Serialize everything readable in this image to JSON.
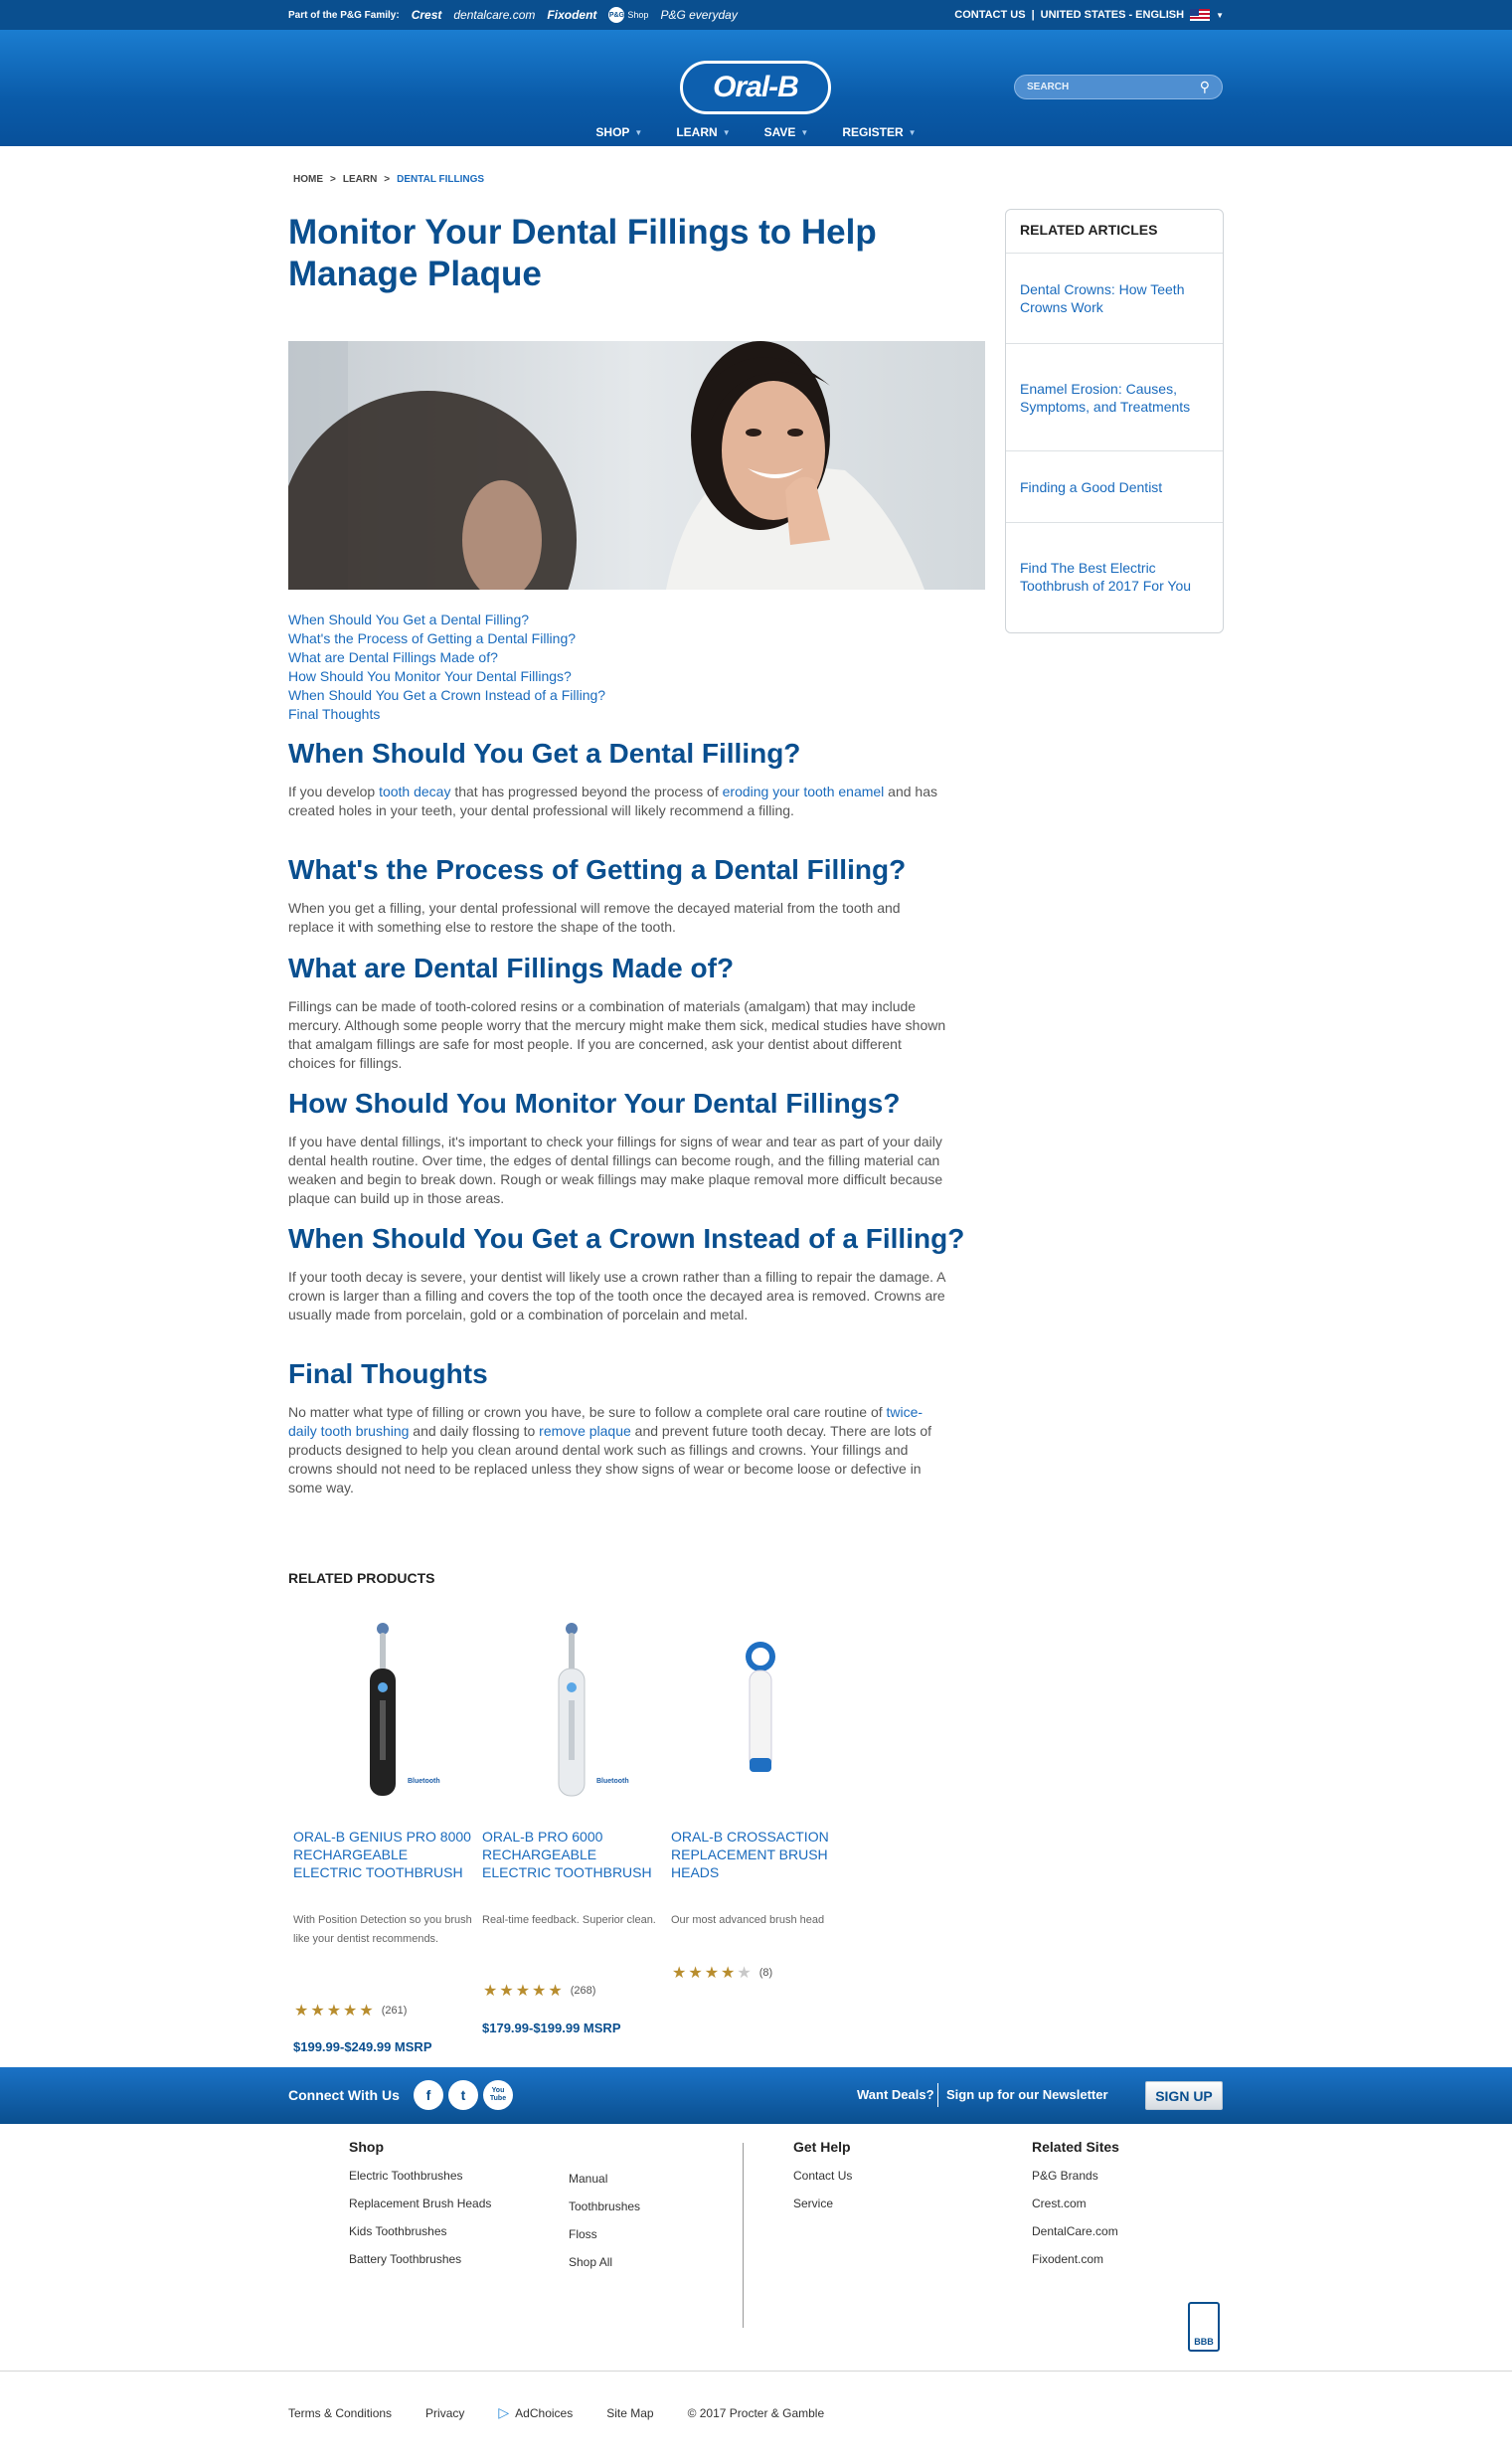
{
  "topbar": {
    "family_label": "Part of the P&G Family:",
    "brands": [
      "Crest",
      "dentalcare.com",
      "Fixodent"
    ],
    "shop_badge": "P&G",
    "shop_label": "Shop",
    "everyday": "P&G everyday",
    "contact": "CONTACT US",
    "region": "UNITED STATES - ENGLISH"
  },
  "header": {
    "logo": "Oral-B",
    "search_placeholder": "SEARCH",
    "nav": [
      "SHOP",
      "LEARN",
      "SAVE",
      "REGISTER"
    ]
  },
  "breadcrumb": {
    "home": "HOME",
    "learn": "LEARN",
    "current": "DENTAL FILLINGS",
    "sep": ">"
  },
  "article": {
    "title": "Monitor Your Dental Fillings to Help Manage Plaque",
    "toc": [
      "When Should You Get a Dental Filling?",
      "What's the Process of Getting a Dental Filling?",
      "What are Dental Fillings Made of?",
      "How Should You Monitor Your Dental Fillings?",
      "When Should You Get a Crown Instead of a Filling?",
      "Final Thoughts"
    ],
    "s1": {
      "heading": "When Should You Get a Dental Filling?",
      "t1": "If you develop ",
      "l1": "tooth decay",
      "t2": " that has progressed beyond the process of ",
      "l2": "eroding your tooth enamel",
      "t3": " and has created holes in your teeth, your dental professional will likely recommend a filling."
    },
    "s2": {
      "heading": "What's the Process of Getting a Dental Filling?",
      "body": "When you get a filling, your dental professional will remove the decayed material from the tooth and replace it with something else to restore the shape of the tooth."
    },
    "s3": {
      "heading": "What are Dental Fillings Made of?",
      "body": "Fillings can be made of tooth-colored resins or a combination of materials (amalgam) that may include mercury. Although some people worry that the mercury might make them sick, medical studies have shown that amalgam fillings are safe for most people. If you are concerned, ask your dentist about different choices for fillings."
    },
    "s4": {
      "heading": "How Should You Monitor Your Dental Fillings?",
      "body": "If you have dental fillings, it's important to check your fillings for signs of wear and tear as part of your daily dental health routine. Over time, the edges of dental fillings can become rough, and the filling material can weaken and begin to break down. Rough or weak fillings may make plaque removal more difficult because plaque can build up in those areas."
    },
    "s5": {
      "heading": "When Should You Get a Crown Instead of a Filling?",
      "body": "If your tooth decay is severe, your dentist will likely use a crown rather than a filling to repair the damage. A crown is larger than a filling and covers the top of the tooth once the decayed area is removed. Crowns are usually made from porcelain, gold or a combination of porcelain and metal."
    },
    "s6": {
      "heading": "Final Thoughts",
      "t1": "No matter what type of filling or crown you have, be sure to follow a complete oral care routine of ",
      "l1": "twice-daily tooth brushing",
      "t2": " and daily flossing to ",
      "l2": "remove plaque",
      "t3": " and prevent future tooth decay. There are lots of products designed to help you clean around dental work such as fillings and crowns. Your fillings and crowns should not need to be replaced unless they show signs of wear or become loose or defective in some way."
    }
  },
  "related_articles": {
    "title": "RELATED ARTICLES",
    "items": [
      "Dental Crowns: How Teeth Crowns Work",
      "Enamel Erosion: Causes, Symptoms, and Treatments",
      "Finding a Good Dentist",
      "Find The Best Electric Toothbrush of 2017 For You"
    ]
  },
  "related_products": {
    "title": "RELATED PRODUCTS",
    "items": [
      {
        "name": "Oral-B GENIUS PRO 8000 Rechargeable Electric Toothbrush",
        "desc": "With Position Detection so you brush like your dentist recommends.",
        "rating": 5,
        "count": "(261)",
        "price": "$199.99-$249.99 MSRP"
      },
      {
        "name": "Oral-B PRO 6000 Rechargeable Electric Toothbrush",
        "desc": "Real-time feedback. Superior clean.",
        "rating": 5,
        "count": "(268)",
        "price": "$179.99-$199.99 MSRP"
      },
      {
        "name": "Oral-B CrossAction Replacement Brush Heads",
        "desc": "Our most advanced brush head",
        "rating": 3.5,
        "count": "(8)",
        "price": ""
      }
    ]
  },
  "connect": {
    "label": "Connect With Us",
    "social": [
      "f",
      "t",
      "You Tube"
    ],
    "deals": "Want Deals?",
    "newsletter": "Sign up for our Newsletter",
    "signup": "SIGN UP"
  },
  "footer": {
    "shop_title": "Shop",
    "shop_col1": [
      "Electric Toothbrushes",
      "Replacement Brush Heads",
      "Kids Toothbrushes",
      "Battery Toothbrushes"
    ],
    "shop_col2": [
      "Manual",
      "Toothbrushes",
      "Floss",
      "Shop All"
    ],
    "help_title": "Get Help",
    "help": [
      "Contact Us",
      "Service"
    ],
    "sites_title": "Related Sites",
    "sites": [
      "P&G Brands",
      "Crest.com",
      "DentalCare.com",
      "Fixodent.com"
    ],
    "bbb": "BBB",
    "legal": {
      "terms": "Terms & Conditions",
      "privacy": "Privacy",
      "adchoices": "AdChoices",
      "sitemap": "Site Map",
      "copyright": "© 2017 Procter & Gamble"
    }
  }
}
